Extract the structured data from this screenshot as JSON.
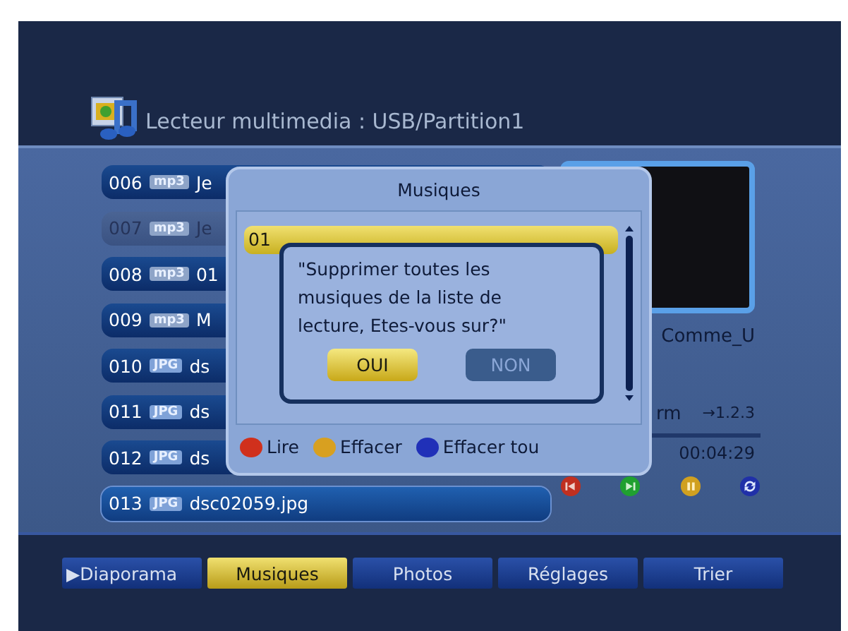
{
  "header": {
    "title": "Lecteur multimedia : USB/Partition1"
  },
  "files": [
    {
      "number": "006",
      "type": "mp3",
      "name": "Je",
      "dimmed": false,
      "selected": false
    },
    {
      "number": "007",
      "type": "mp3",
      "name": "Je",
      "dimmed": true,
      "selected": false
    },
    {
      "number": "008",
      "type": "mp3",
      "name": "01",
      "dimmed": false,
      "selected": false
    },
    {
      "number": "009",
      "type": "mp3",
      "name": "M",
      "dimmed": false,
      "selected": false
    },
    {
      "number": "010",
      "type": "JPG",
      "name": "ds",
      "dimmed": false,
      "selected": false
    },
    {
      "number": "011",
      "type": "JPG",
      "name": "ds",
      "dimmed": false,
      "selected": false
    },
    {
      "number": "012",
      "type": "JPG",
      "name": "ds",
      "dimmed": false,
      "selected": false
    },
    {
      "number": "013",
      "type": "JPG",
      "name": "dsc02059.jpg",
      "dimmed": false,
      "selected": true
    }
  ],
  "preview": {
    "caption": "Comme_U",
    "track": "rm",
    "order": "→1.2.3",
    "time": "00:04:29"
  },
  "playlist": {
    "title": "Musiques",
    "items": [
      {
        "number": "01",
        "selected": true
      }
    ],
    "legend": [
      {
        "color": "#d0301c",
        "label": "Lire"
      },
      {
        "color": "#d8a020",
        "label": "Effacer"
      },
      {
        "color": "#2030b8",
        "label": "Effacer tou"
      }
    ]
  },
  "confirm": {
    "message": "\"Supprimer toutes les musiques de la liste de lecture, Etes-vous sur?\"",
    "buttons": [
      {
        "label": "OUI",
        "selected": true
      },
      {
        "label": "NON",
        "selected": false
      }
    ]
  },
  "tabs": [
    {
      "label": "▶Diaporama",
      "selected": false
    },
    {
      "label": "Musiques",
      "selected": true
    },
    {
      "label": "Photos",
      "selected": false
    },
    {
      "label": "Réglages",
      "selected": false
    },
    {
      "label": "Trier",
      "selected": false
    }
  ]
}
